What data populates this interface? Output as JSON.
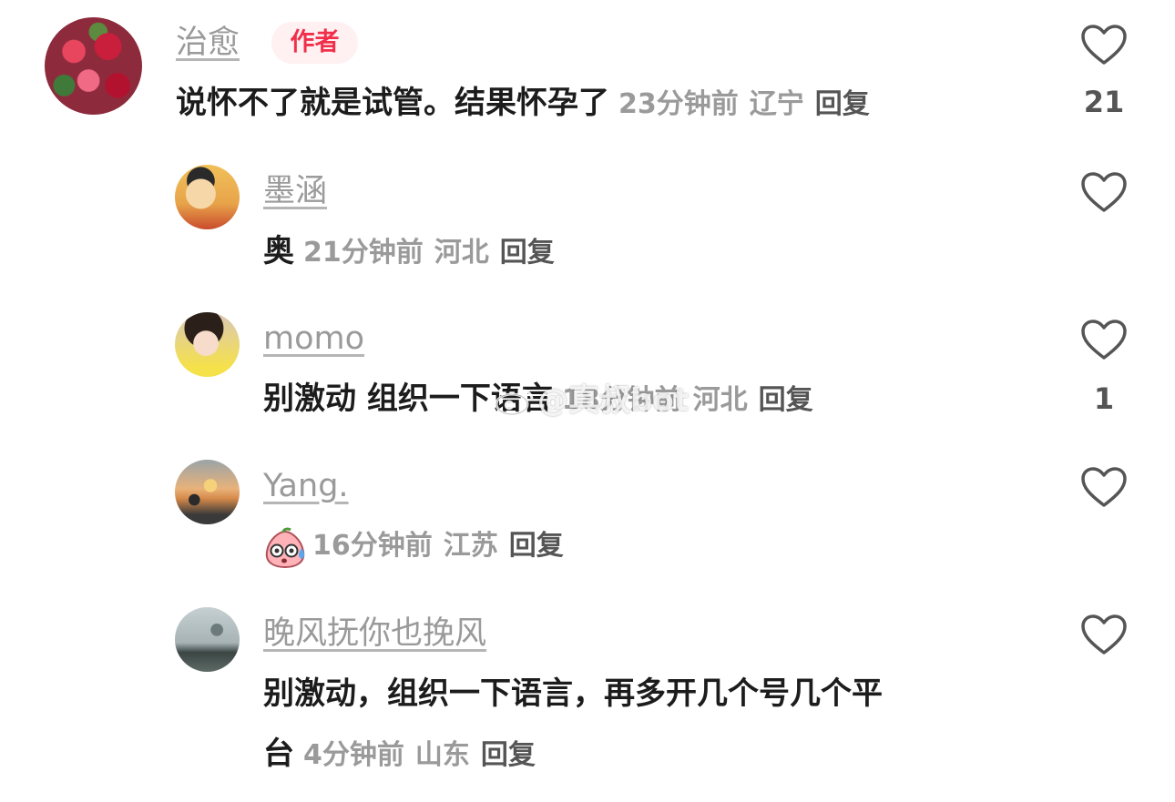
{
  "comments": [
    {
      "username": "治愈",
      "badge": "作者",
      "text": "说怀不了就是试管。结果怀孕了",
      "time": "23分钟前",
      "location": "辽宁",
      "reply": "回复",
      "likes": "21"
    },
    {
      "username": "墨涵",
      "text": "奥",
      "time": "21分钟前",
      "location": "河北",
      "reply": "回复",
      "likes": ""
    },
    {
      "username": "momo",
      "text": "别激动 组织一下语言",
      "time": "18分钟前",
      "location": "河北",
      "reply": "回复",
      "likes": "1"
    },
    {
      "username": "Yang.",
      "text": "",
      "time": "16分钟前",
      "location": "江苏",
      "reply": "回复",
      "likes": "",
      "sticker": "sweating-peach-emoji"
    },
    {
      "username": "晚风抚你也挽风",
      "text_line1": "别激动，组织一下语言，再多开几个号几个平",
      "text_line2": "台",
      "time": "4分钟前",
      "location": "山东",
      "reply": "回复",
      "likes": ""
    }
  ],
  "watermark": "@真叔bot",
  "icons": {
    "like": "heart-outline-icon",
    "weibo": "weibo-logo-icon"
  },
  "colors": {
    "badge_text": "#f0304a",
    "badge_bg": "#fff0f2",
    "meta": "#9a9a9a",
    "username": "#9a9a9a"
  }
}
